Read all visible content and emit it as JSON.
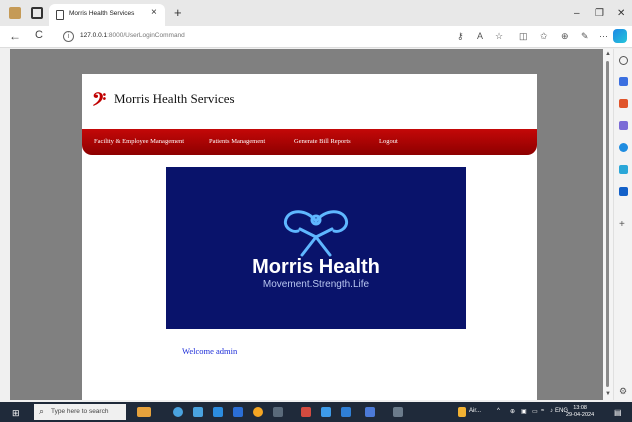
{
  "browser": {
    "tab_title": "Morris Health Services",
    "tab_close": "×",
    "new_tab": "+",
    "minimize": "–",
    "restore": "❐",
    "close": "✕",
    "back": "←",
    "refresh": "C",
    "url_host": "127.0.0.1",
    "url_rest": ":8000/UserLoginCommand"
  },
  "page": {
    "brand_mark": "𝄢",
    "brand_name": "Morris Health Services",
    "menu": [
      {
        "label": "Facility & Employee Management"
      },
      {
        "label": "Patients Management"
      },
      {
        "label": "Generate Bill Reports"
      },
      {
        "label": "Logout"
      }
    ],
    "logo": {
      "title": "Morris Health",
      "tagline": "Movement.Strength.Life",
      "bg_color": "#09136b",
      "accent_color": "#5fb7ff"
    },
    "welcome": "Welcome admin"
  },
  "colors": {
    "menubar": "#b00000",
    "viewport_bg": "#808080",
    "welcome_text": "#1a2bd8"
  },
  "taskbar": {
    "search_placeholder": "Type here to search",
    "weather": "Air...",
    "language": "ENG",
    "time": "13:08",
    "date": "29-04-2024"
  }
}
